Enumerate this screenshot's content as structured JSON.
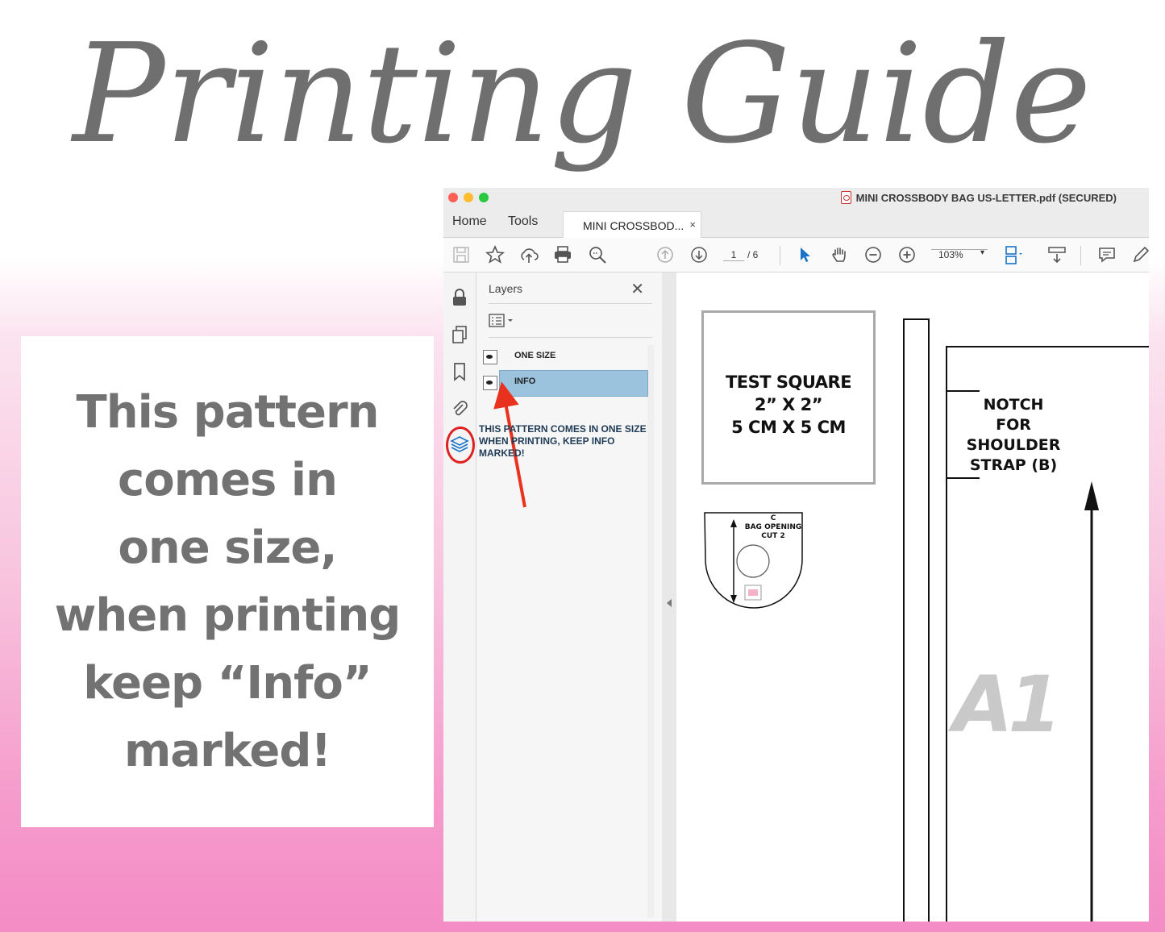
{
  "title": "Printing Guide",
  "infobox": {
    "lines": [
      "This pattern",
      "comes in",
      "one size,",
      "when printing",
      "keep “Info”",
      "marked!"
    ]
  },
  "window": {
    "title": "MINI CROSSBODY BAG US-LETTER.pdf (SECURED)",
    "tabs": {
      "home": "Home",
      "tools": "Tools",
      "doc": "MINI CROSSBOD...",
      "close": "×"
    }
  },
  "toolbar": {
    "page_current": "1",
    "page_total": "/ 6",
    "zoom": "103%",
    "zoom_caret": "▾"
  },
  "layers_panel": {
    "header": "Layers",
    "close": "✕",
    "layers": [
      {
        "label": "ONE SIZE",
        "selected": false
      },
      {
        "label": "INFO",
        "selected": true
      }
    ],
    "note": [
      "THIS PATTERN COMES IN ONE SIZE",
      "WHEN PRINTING, KEEP INFO",
      "MARKED!"
    ]
  },
  "document": {
    "test_square": [
      "TEST SQUARE",
      "2” X 2”",
      "5 CM X 5 CM"
    ],
    "notch_label": [
      "NOTCH",
      "FOR",
      "SHOULDER",
      "STRAP (B)"
    ],
    "piece_label": "A1",
    "piece_c": [
      "C",
      "BAG OPENING",
      "CUT 2"
    ]
  },
  "colors": {
    "highlight_red": "#e02020",
    "layer_selected": "#9cc3de",
    "title_gray": "#6f6f6f",
    "pink": "#f48cc5"
  },
  "icons": [
    "save-icon",
    "star-icon",
    "cloud-upload-icon",
    "print-icon",
    "zoom-search-icon",
    "page-up-icon",
    "page-down-icon",
    "select-arrow-icon",
    "hand-icon",
    "zoom-out-icon",
    "zoom-in-icon",
    "fit-page-icon",
    "scroll-mode-icon",
    "comment-icon",
    "pen-icon",
    "lock-icon",
    "pages-icon",
    "bookmark-icon",
    "paperclip-icon",
    "layers-icon",
    "eye-icon",
    "options-icon"
  ]
}
